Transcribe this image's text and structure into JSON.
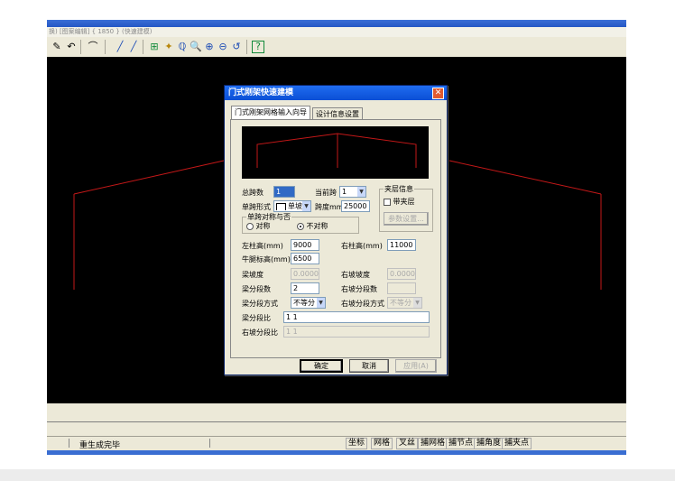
{
  "menubar": {
    "text": "换)  [图案编辑]  {  1850  }  (快速建模)"
  },
  "toolbar": {
    "icons": [
      "brush-icon",
      "undo-icon",
      "arc-icon",
      "line-icon",
      "line2-icon",
      "grid-icon",
      "node-icon",
      "snap-icon",
      "zoom-icon",
      "zoom-in-icon",
      "zoom-out-icon",
      "zoom-prev-icon",
      "help-icon"
    ],
    "glyphs": [
      "✎",
      "↶",
      "⌒",
      "╱",
      "╱",
      "⊞",
      "✦",
      "ℚ",
      "🔍",
      "⊕",
      "⊖",
      "↺",
      "?"
    ]
  },
  "dialog": {
    "title": "门式刚架快速建模",
    "close": "✕",
    "tabs": [
      {
        "label": "门式刚架网格输入向导"
      },
      {
        "label": "设计信息设置"
      }
    ],
    "fields": {
      "total_spans_label": "总跨数",
      "total_spans_value": "1",
      "current_span_label": "当前跨",
      "current_span_value": "1",
      "span_form_label": "单跨形式",
      "span_form_value": "单坡",
      "span_length_label": "跨度mm",
      "span_length_value": "25000",
      "symmetry_group": "单跨对称与否",
      "symmetric_label": "对称",
      "asymmetric_label": "不对称",
      "mezzanine_group": "夹层信息",
      "mezzanine_check": "带夹层",
      "param_button": "参数设置...",
      "left_col_label": "左柱高(mm)",
      "left_col_value": "9000",
      "right_col_label": "右柱高(mm)",
      "right_col_value": "11000",
      "corbel_label": "牛腿标高(mm)",
      "corbel_value": "6500",
      "beam_slope_label": "梁坡度",
      "beam_slope_value": "0.0000",
      "right_slope_label": "右坡坡度",
      "right_slope_value": "0.0000",
      "beam_segments_label": "梁分段数",
      "beam_segments_value": "2",
      "right_segments_label": "右坡分段数",
      "right_segments_value": "",
      "beam_seg_method_label": "梁分段方式",
      "beam_seg_method_value": "不等分",
      "right_seg_method_label": "右坡分段方式",
      "right_seg_method_value": "不等分",
      "beam_ratio_label": "梁分段比",
      "beam_ratio_value": "1 1",
      "right_ratio_label": "右坡分段比",
      "right_ratio_value": "1 1"
    },
    "buttons": {
      "ok": "确定",
      "cancel": "取消",
      "apply": "应用(A)"
    }
  },
  "status": {
    "message": "重生成完毕",
    "snaps": [
      "坐标",
      "网格",
      "叉丝",
      "捕网格",
      "捕节点",
      "捕角度",
      "捕夹点"
    ]
  },
  "colors": {
    "frame_line": "#c41818",
    "canvas": "#000000",
    "titlebar": "#0b4fd5"
  }
}
